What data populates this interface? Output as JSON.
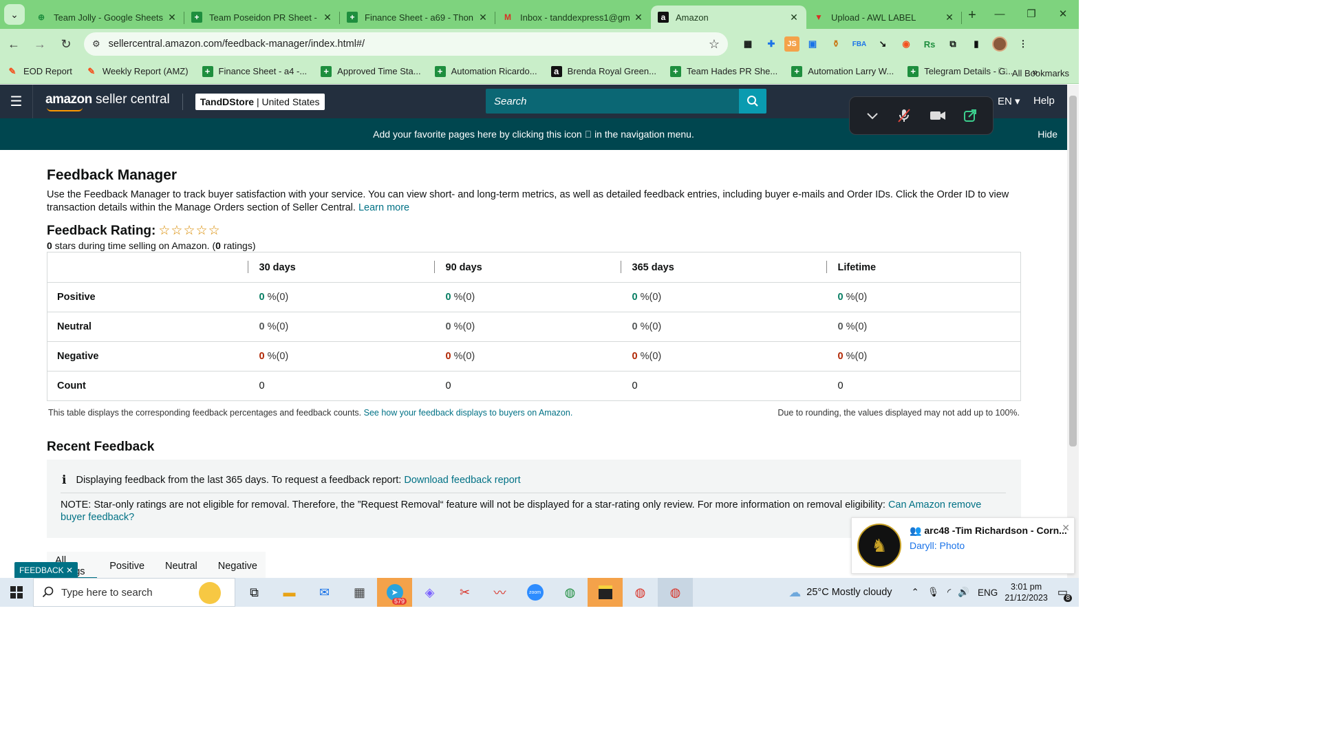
{
  "browser": {
    "tabs": [
      {
        "label": "Team Jolly - Google Sheets",
        "icon": "sheets-icon",
        "active": false
      },
      {
        "label": "Team Poseidon PR Sheet -",
        "icon": "sheets-icon",
        "active": false
      },
      {
        "label": "Finance Sheet - a69 - Thon",
        "icon": "sheets-icon",
        "active": false
      },
      {
        "label": "Inbox - tanddexpress1@gm",
        "icon": "gmail-icon",
        "active": false
      },
      {
        "label": "Amazon",
        "icon": "amazon-icon",
        "active": true
      },
      {
        "label": "Upload - AWL LABEL",
        "icon": "awl-icon",
        "active": false
      }
    ],
    "url": "sellercentral.amazon.com/feedback-manager/index.html#/",
    "bookmarks": [
      {
        "label": "EOD Report",
        "icon": "pencil-icon"
      },
      {
        "label": "Weekly Report (AMZ)",
        "icon": "pencil-icon"
      },
      {
        "label": "Finance Sheet - a4 -...",
        "icon": "sheets-icon"
      },
      {
        "label": "Approved Time Sta...",
        "icon": "sheets-icon"
      },
      {
        "label": "Automation Ricardo...",
        "icon": "sheets-icon"
      },
      {
        "label": "Brenda Royal Green...",
        "icon": "amazon-icon"
      },
      {
        "label": "Team Hades PR She...",
        "icon": "sheets-icon"
      },
      {
        "label": "Automation Larry W...",
        "icon": "sheets-icon"
      },
      {
        "label": "Telegram Details - G...",
        "icon": "sheets-icon"
      }
    ],
    "all_bookmarks": "All Bookmarks"
  },
  "header": {
    "logo_amazon": "amazon",
    "logo_rest": " seller central",
    "store_name": "TandDStore",
    "store_region": "United States",
    "search_placeholder": "Search",
    "language": "EN",
    "help": "Help"
  },
  "banner": {
    "text": "Add your favorite pages here by clicking this icon",
    "text_after": "in the navigation menu.",
    "hide": "Hide"
  },
  "page": {
    "title": "Feedback Manager",
    "description": "Use the Feedback Manager to track buyer satisfaction with your service. You can view short- and long-term metrics, as well as detailed feedback entries, including buyer e-mails and Order IDs. Click the Order ID to view transaction details within the Manage Orders section of Seller Central.",
    "learn_more": "Learn more",
    "rating_label": "Feedback Rating:",
    "stars_value": 0,
    "stars_max": 5,
    "rating_count_stars": "0",
    "rating_sub_mid": " stars during time selling on Amazon. (",
    "rating_count_ratings": "0",
    "rating_sub_end": " ratings)"
  },
  "table": {
    "columns": [
      "",
      "30 days",
      "90 days",
      "365 days",
      "Lifetime"
    ],
    "rows": [
      {
        "label": "Positive",
        "cells": [
          {
            "n": "0",
            "p": "%(0)"
          },
          {
            "n": "0",
            "p": "%(0)"
          },
          {
            "n": "0",
            "p": "%(0)"
          },
          {
            "n": "0",
            "p": "%(0)"
          }
        ]
      },
      {
        "label": "Neutral",
        "cells": [
          {
            "n": "0",
            "p": "%(0)"
          },
          {
            "n": "0",
            "p": "%(0)"
          },
          {
            "n": "0",
            "p": "%(0)"
          },
          {
            "n": "0",
            "p": "%(0)"
          }
        ]
      },
      {
        "label": "Negative",
        "cells": [
          {
            "n": "0",
            "p": "%(0)"
          },
          {
            "n": "0",
            "p": "%(0)"
          },
          {
            "n": "0",
            "p": "%(0)"
          },
          {
            "n": "0",
            "p": "%(0)"
          }
        ]
      },
      {
        "label": "Count",
        "cells": [
          {
            "n": "0"
          },
          {
            "n": "0"
          },
          {
            "n": "0"
          },
          {
            "n": "0"
          }
        ]
      }
    ],
    "note": "This table displays the corresponding feedback percentages and feedback counts.",
    "note_link": "See how your feedback displays to buyers on Amazon.",
    "rounding_note": "Due to rounding, the values displayed may not add up to 100%."
  },
  "recent": {
    "title": "Recent Feedback",
    "info_text": "Displaying feedback from the last 365 days. To request a feedback report:",
    "info_link": "Download feedback report",
    "note_text": "NOTE: Star-only ratings are not eligible for removal. Therefore, the ”Request Removal“ feature will not be displayed for a star-rating only review. For more information on removal eligibility:",
    "note_link": "Can Amazon remove buyer feedback?",
    "tabs": [
      "All ratings",
      "Positive",
      "Neutral",
      "Negative"
    ]
  },
  "feedback_tab": "FEEDBACK",
  "notification": {
    "title": "arc48 -Tim Richardson - Corn...",
    "body": "Daryll: Photo"
  },
  "taskbar": {
    "search_placeholder": "Type here to search",
    "telegram_badge": "579",
    "weather": "25°C  Mostly cloudy",
    "lang": "ENG",
    "time": "3:01 pm",
    "date": "21/12/2023",
    "notif_count": "8"
  },
  "colors": {
    "positive": "#067d62",
    "negative": "#b12704",
    "link": "#007185",
    "header": "#232f3e",
    "banner": "#00464f",
    "chrome": "#7ed37e"
  }
}
